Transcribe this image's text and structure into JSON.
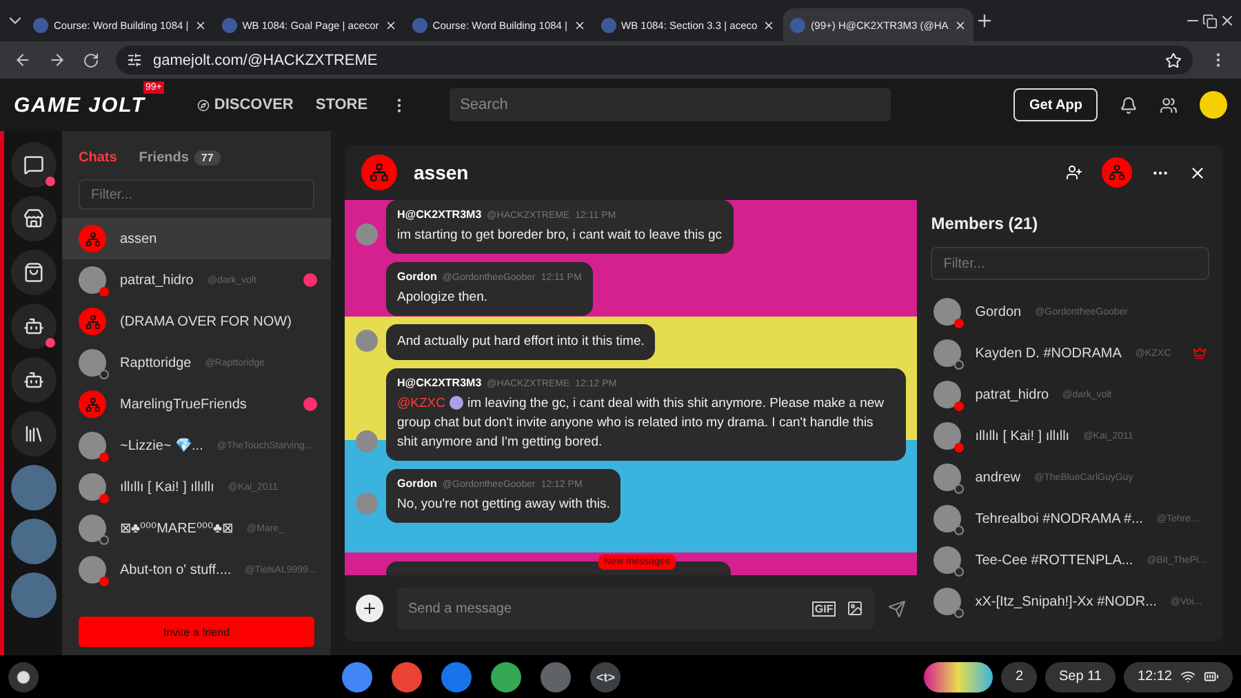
{
  "browser": {
    "tabs": [
      {
        "title": "Course: Word Building 1084 |",
        "selected": false
      },
      {
        "title": "WB 1084: Goal Page | acecor",
        "selected": false
      },
      {
        "title": "Course: Word Building 1084 |",
        "selected": false
      },
      {
        "title": "WB 1084: Section 3.3 | aceco",
        "selected": false
      },
      {
        "title": "(99+) H@CK2XTR3M3 (@HA",
        "selected": true
      }
    ],
    "url": "gamejolt.com/@HACKZXTREME"
  },
  "topbar": {
    "logo": "GAME JOLT",
    "logo_badge": "99+",
    "nav": [
      "DISCOVER",
      "STORE"
    ],
    "search": {
      "placeholder": "Search"
    },
    "get_app": "Get App"
  },
  "rail": {
    "items": [
      {
        "notice": true
      },
      {
        "notice": false
      },
      {
        "notice": false
      },
      {
        "notice": true
      },
      {
        "notice": false
      },
      {
        "notice": false
      }
    ]
  },
  "chats_panel": {
    "tabs": [
      {
        "label": "Chats",
        "selected": true
      },
      {
        "label": "Friends",
        "count": "77",
        "selected": false
      }
    ],
    "filter": {
      "placeholder": "Filter..."
    },
    "items": [
      {
        "kind": "group",
        "name": "assen",
        "selected": true,
        "unread": false
      },
      {
        "kind": "user",
        "name": "patrat_hidro",
        "handle": "@dark_volt",
        "online": true,
        "selected": false,
        "unread": true
      },
      {
        "kind": "group",
        "name": "(DRAMA OVER FOR NOW)",
        "selected": false,
        "unread": false
      },
      {
        "kind": "user",
        "name": "Rapttoridge",
        "handle": "@Rapttoridge",
        "online": false,
        "selected": false,
        "unread": false
      },
      {
        "kind": "group",
        "name": "MarelingTrueFriends",
        "selected": false,
        "unread": true
      },
      {
        "kind": "user",
        "name": "~Lizzie~ 💎...",
        "handle": "@TheTouchStarving...",
        "online": true,
        "selected": false,
        "unread": false
      },
      {
        "kind": "user",
        "name": "ıllıllı [ Kai! ] ıllıllı",
        "handle": "@Kai_2011",
        "online": true,
        "selected": false,
        "unread": false
      },
      {
        "kind": "user",
        "name": "⊠♣⁰⁰⁰MARE⁰⁰⁰♣⊠",
        "handle": "@Mare_",
        "online": false,
        "selected": false,
        "unread": false
      },
      {
        "kind": "user",
        "name": "Abut-ton o' stuff....",
        "handle": "@TielsAL9999...",
        "online": true,
        "selected": false,
        "unread": false
      }
    ],
    "invite": "Invite a friend"
  },
  "chat": {
    "title": "assen",
    "messages": [
      {
        "author": "H@CK2XTR3M3",
        "handle": "@HACKZXTREME",
        "time": "12:11 PM",
        "text": "im starting to get boreder bro, i cant wait to leave this gc",
        "avatar": true
      },
      {
        "author": "Gordon",
        "handle": "@GordontheeGoober",
        "time": "12:11 PM",
        "text": "Apologize then.",
        "avatar": false
      },
      {
        "text": "And actually put hard effort into it this time.",
        "avatar": true
      },
      {
        "author": "H@CK2XTR3M3",
        "handle": "@HACKZXTREME",
        "time": "12:12 PM",
        "mention": "@KZXC",
        "text": "im leaving the gc, i cant deal with this shit anymore. Please make a new group chat but don't invite anyone who is related into my drama. I can't handle this shit anymore and I'm getting bored.",
        "avatar": true
      },
      {
        "author": "Gordon",
        "handle": "@GordontheeGoober",
        "time": "12:12 PM",
        "text": "No, you're not getting away with this.",
        "avatar": true
      }
    ],
    "new_messages": "New messages",
    "input": {
      "placeholder": "Send a message"
    },
    "gif": "GIF",
    "members": {
      "title": "Members (21)",
      "filter": {
        "placeholder": "Filter..."
      },
      "items": [
        {
          "name": "Gordon",
          "handle": "@GordontheeGoober",
          "online": true,
          "owner": false
        },
        {
          "name": "Kayden D. #NODRAMA",
          "handle": "@KZXC",
          "online": false,
          "owner": true
        },
        {
          "name": "patrat_hidro",
          "handle": "@dark_volt",
          "online": true,
          "owner": false
        },
        {
          "name": "ıllıllı [ Kai! ] ıllıllı",
          "handle": "@Kai_2011",
          "online": true,
          "owner": false
        },
        {
          "name": "andrew",
          "handle": "@TheBlueCarlGuyGuy",
          "online": false,
          "owner": false
        },
        {
          "name": "Tehrealboi #NODRAMA #...",
          "handle": "@Tehre...",
          "online": false,
          "owner": false
        },
        {
          "name": "Tee-Cee #ROTTENPLA...",
          "handle": "@Bit_ThePi...",
          "online": false,
          "owner": false
        },
        {
          "name": "xX-[Itz_Snipah!]-Xx #NODR...",
          "handle": "@Voi...",
          "online": false,
          "owner": false
        }
      ]
    }
  },
  "taskbar": {
    "apps": [
      {
        "color": "#4285f4"
      },
      {
        "color": "#ea4335"
      },
      {
        "color": "#1a73e8"
      },
      {
        "color": "#34a853"
      },
      {
        "color": "#5f6368"
      },
      {
        "color": "#3c4043",
        "label": "<t>"
      }
    ],
    "notifications": "2",
    "date": "Sep 11",
    "time": "12:12"
  }
}
